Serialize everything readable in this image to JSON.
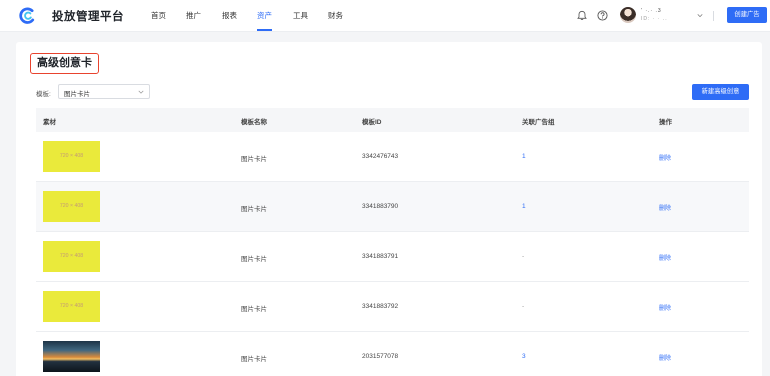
{
  "app": {
    "title": "投放管理平台"
  },
  "nav": [
    {
      "label": "首页",
      "active": false
    },
    {
      "label": "推广",
      "active": false
    },
    {
      "label": "报表",
      "active": false
    },
    {
      "label": "资产",
      "active": true
    },
    {
      "label": "工具",
      "active": false
    },
    {
      "label": "财务",
      "active": false
    }
  ],
  "user": {
    "name": "'  ·.·  .3",
    "id": "ID:   ·  ·  .."
  },
  "header_actions": {
    "create_ad": "创建广告"
  },
  "page": {
    "title": "高级创意卡",
    "template_label": "模板:",
    "template_value": "图片卡片",
    "new_button": "新建高级创意"
  },
  "table": {
    "columns": [
      "素材",
      "模板名称",
      "模板ID",
      "关联广告组",
      "操作"
    ],
    "rows": [
      {
        "material": "720 × 408",
        "template_name": "图片卡片",
        "template_id": "3342476743",
        "ad_groups": "1",
        "action": "删除"
      },
      {
        "material": "720 × 408",
        "template_name": "图片卡片",
        "template_id": "3341883790",
        "ad_groups": "1",
        "action": "删除"
      },
      {
        "material": "720 × 408",
        "template_name": "图片卡片",
        "template_id": "3341883791",
        "ad_groups": "-",
        "action": "删除"
      },
      {
        "material": "720 × 408",
        "template_name": "图片卡片",
        "template_id": "3341883792",
        "ad_groups": "-",
        "action": "删除"
      },
      {
        "material": "",
        "template_name": "图片卡片",
        "template_id": "2031577078",
        "ad_groups": "3",
        "action": "删除"
      }
    ]
  },
  "colors": {
    "accent": "#2e6cf6",
    "thumbnail": "#eaea3b",
    "highlight": "#e8432e"
  },
  "icons": {
    "logo": "logo-icon",
    "bell": "bell-icon",
    "help": "help-icon",
    "caret": "chevron-down-icon"
  }
}
